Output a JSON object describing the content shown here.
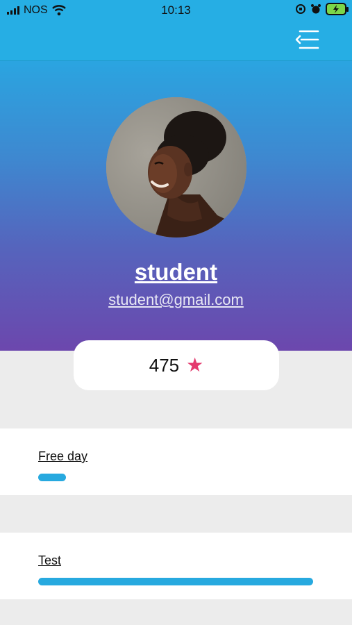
{
  "status_bar": {
    "carrier": "NOS",
    "time": "10:13"
  },
  "profile": {
    "username": "student",
    "email": "student@gmail.com",
    "avatar_icon": "profile-photo"
  },
  "points": {
    "value": "475",
    "star": "★",
    "star_color": "#e43a6e"
  },
  "goals": [
    {
      "title": "Free day",
      "progress": 0.1
    },
    {
      "title": "Test",
      "progress": 1.0
    }
  ],
  "colors": {
    "accent": "#27a9df",
    "header_top": "#26aee4",
    "gradient_bottom": "#6c47ad"
  }
}
